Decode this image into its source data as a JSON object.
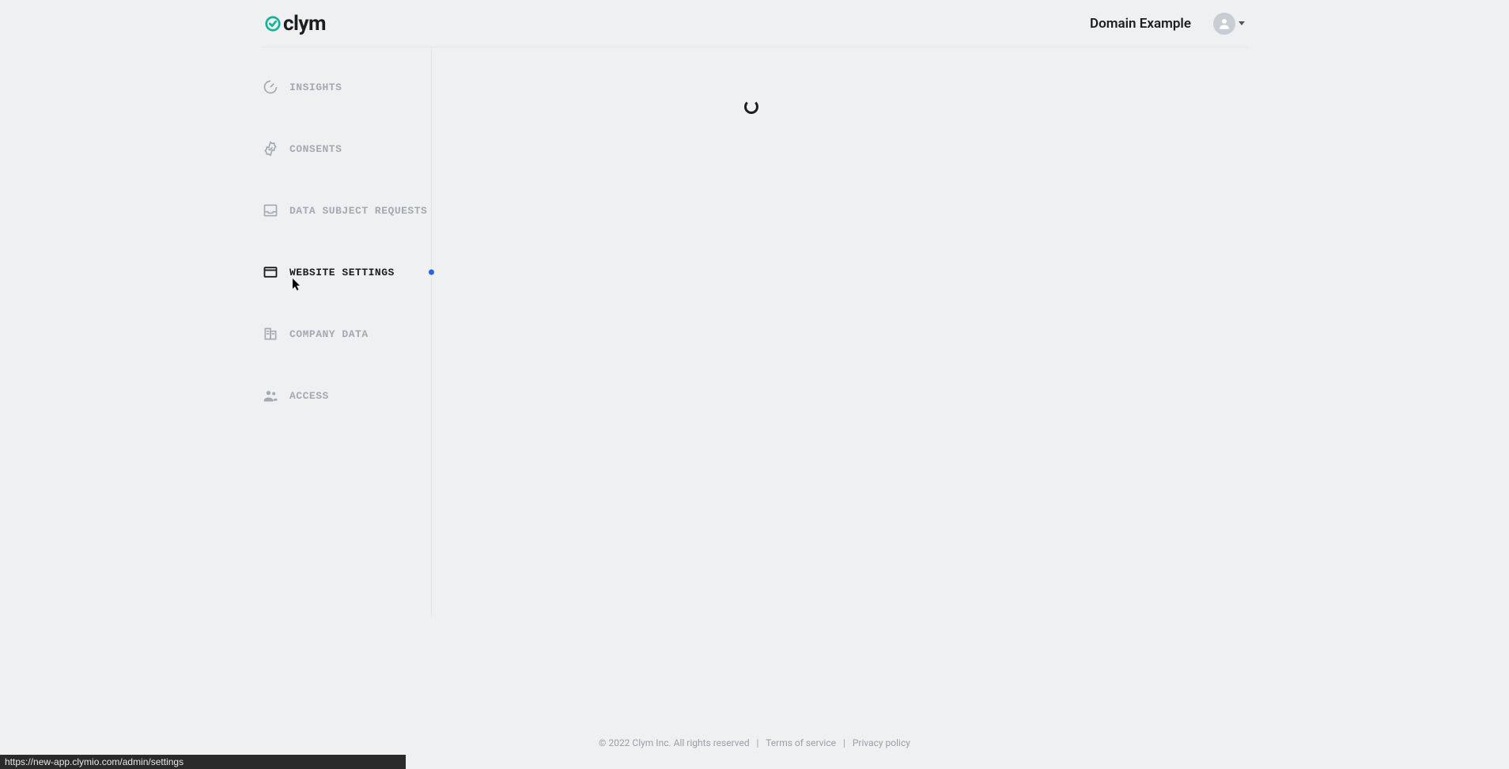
{
  "header": {
    "logo_text": "clym",
    "domain_label": "Domain Example"
  },
  "sidebar": {
    "items": [
      {
        "label": "INSIGHTS",
        "active": false
      },
      {
        "label": "CONSENTS",
        "active": false
      },
      {
        "label": "DATA SUBJECT REQUESTS",
        "active": false
      },
      {
        "label": "WEBSITE SETTINGS",
        "active": true
      },
      {
        "label": "COMPANY DATA",
        "active": false
      },
      {
        "label": "ACCESS",
        "active": false
      }
    ]
  },
  "footer": {
    "copyright": "© 2022 Clym Inc. All rights reserved",
    "separator": "|",
    "terms_label": "Terms of service",
    "privacy_label": "Privacy policy"
  },
  "status_bar": {
    "url": "https://new-app.clymio.com/admin/settings"
  }
}
